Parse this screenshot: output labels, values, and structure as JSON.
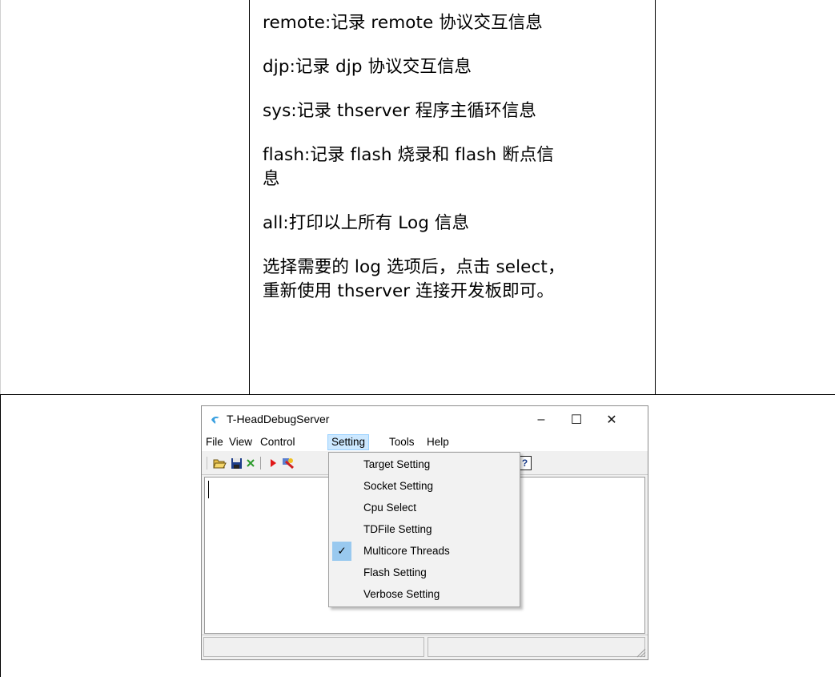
{
  "doc": {
    "lines": [
      "remote:记录 remote 协议交互信息",
      "djp:记录 djp 协议交互信息",
      "sys:记录 thserver 程序主循环信息",
      "flash:记录 flash 烧录和 flash 断点信",
      "息",
      "all:打印以上所有 Log 信息",
      "选择需要的 log 选项后，点击 select，",
      "重新使用 thserver 连接开发板即可。"
    ]
  },
  "window": {
    "title": "T-HeadDebugServer",
    "controls": {
      "minimize": "–",
      "maximize": "☐",
      "close": "✕"
    },
    "menus": [
      "File",
      "View",
      "Control",
      "Setting",
      "Tools",
      "Help"
    ],
    "active_menu": "Setting",
    "toolbar_icons": [
      "open-folder-icon",
      "save-icon",
      "delete-icon",
      "run-icon",
      "connect-icon",
      "help-icon"
    ]
  },
  "setting_menu": {
    "items": [
      {
        "label": "Target Setting",
        "checked": false
      },
      {
        "label": "Socket Setting",
        "checked": false
      },
      {
        "label": "Cpu Select",
        "checked": false
      },
      {
        "label": "TDFile Setting",
        "checked": false
      },
      {
        "label": "Multicore Threads",
        "checked": true
      },
      {
        "label": "Flash Setting",
        "checked": false
      },
      {
        "label": "Verbose Setting",
        "checked": false
      }
    ],
    "check_glyph": "✓"
  },
  "colors": {
    "menu_highlight": "#cce8ff",
    "check_background": "#99c9ef"
  }
}
